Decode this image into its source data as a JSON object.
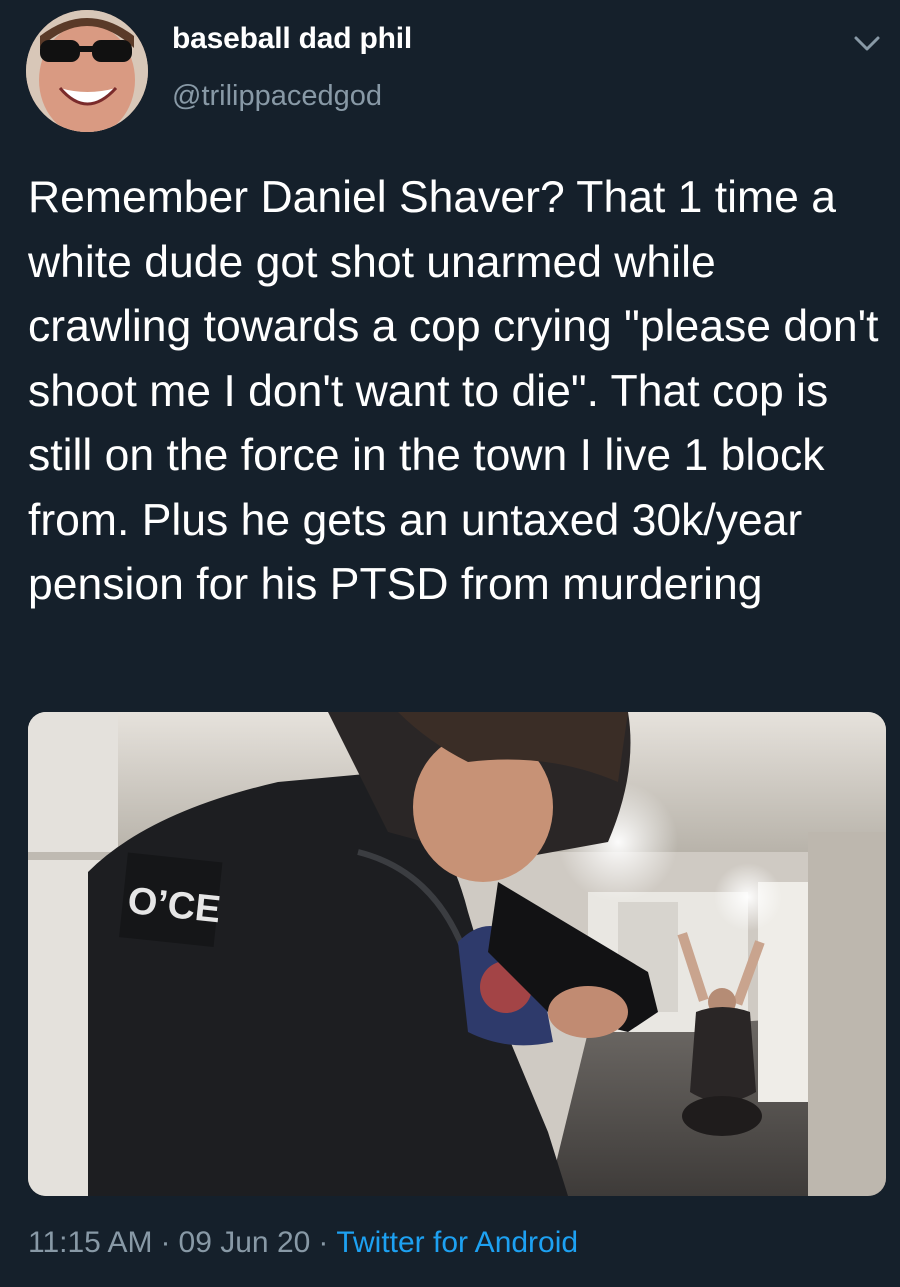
{
  "user": {
    "display_name": "baseball dad phil",
    "handle": "@trilippacedgod"
  },
  "tweet": {
    "text": "Remember Daniel Shaver? That 1 time a white dude got shot unarmed while crawling towards a cop crying \"please don't shoot me I don't want to die\". That cop is still on the force in the town I live 1 block from. Plus he gets an untaxed 30k/year pension for his PTSD from murdering",
    "image_text": "O’CE",
    "time": "11:15 AM",
    "date": "09 Jun 20",
    "separator": "·",
    "source": "Twitter for Android"
  },
  "icons": {
    "menu": "chevron-down-icon"
  },
  "colors": {
    "background": "#15202b",
    "text": "#ffffff",
    "secondary": "#8899a6",
    "link": "#1da1f2"
  }
}
